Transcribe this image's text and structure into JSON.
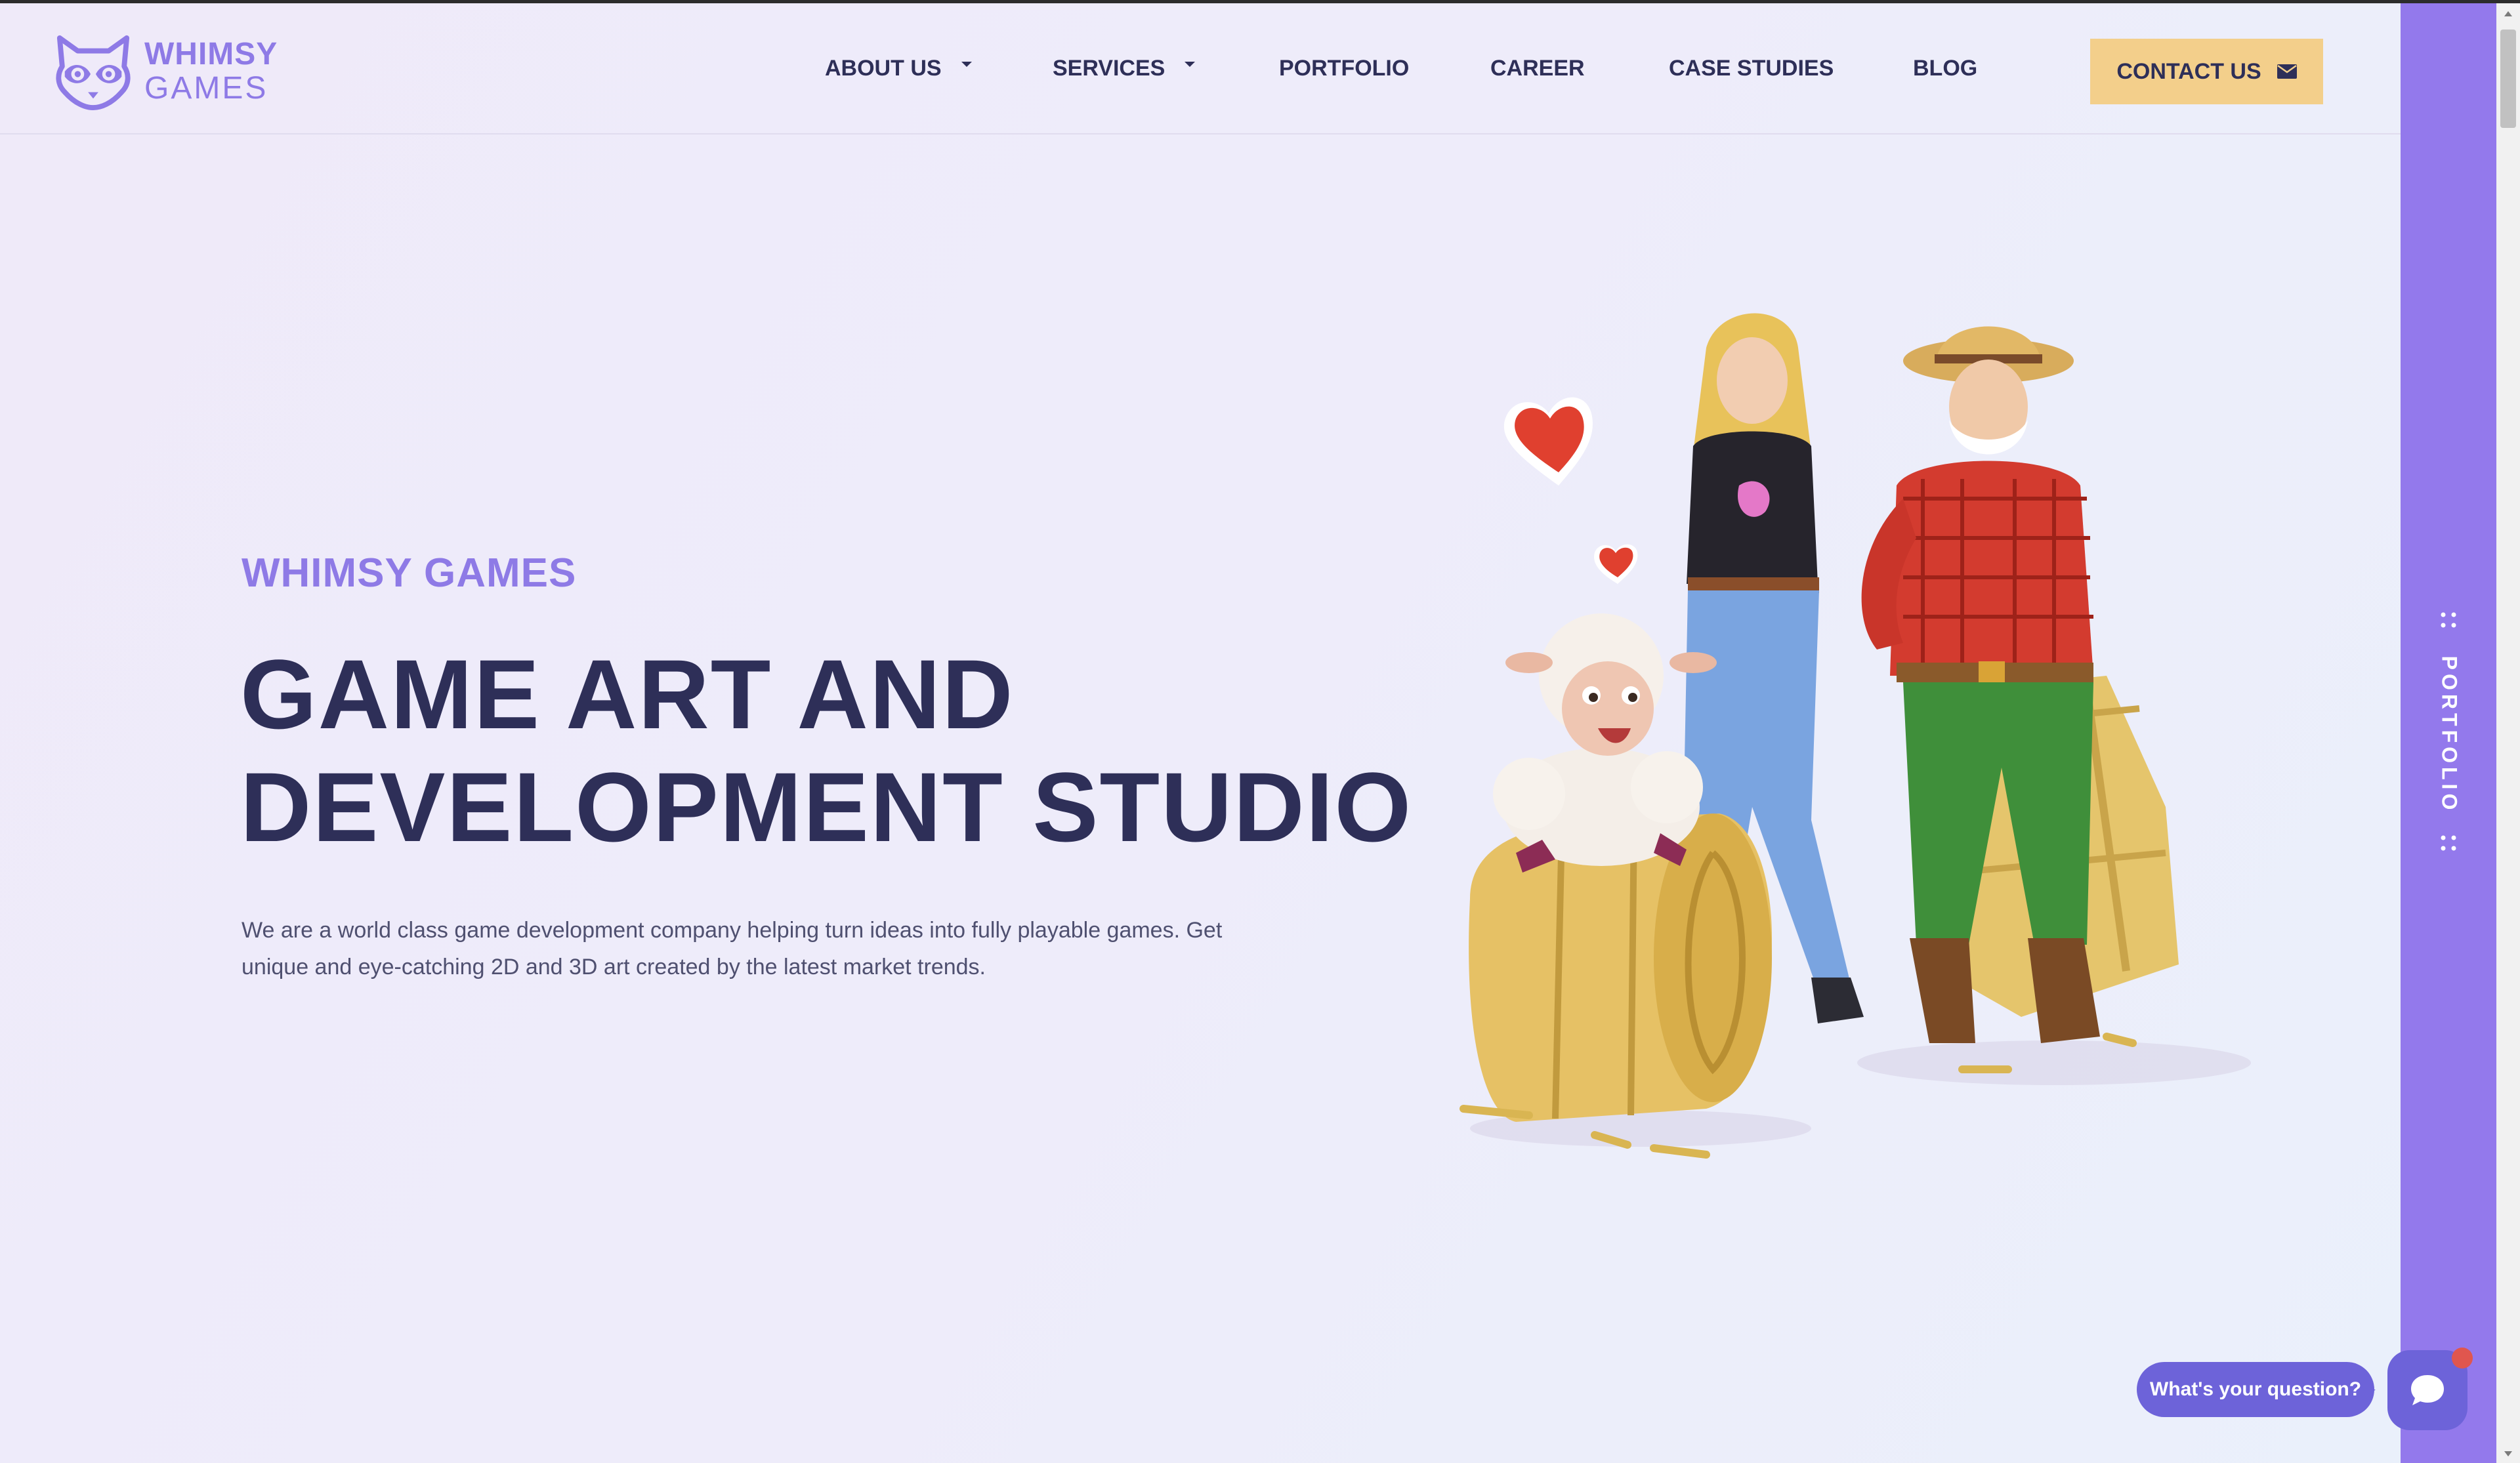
{
  "brand": {
    "logo_line1": "WHIMSY",
    "logo_line2": "GAMES",
    "accent_color": "#8e7ae6",
    "dark_color": "#2e2f58",
    "button_color": "#f3cf8b",
    "rail_color": "#9379ec"
  },
  "nav": {
    "items": [
      {
        "label": "ABOUT US",
        "has_dropdown": true
      },
      {
        "label": "SERVICES",
        "has_dropdown": true
      },
      {
        "label": "PORTFOLIO",
        "has_dropdown": false
      },
      {
        "label": "CAREER",
        "has_dropdown": false
      },
      {
        "label": "CASE STUDIES",
        "has_dropdown": false
      },
      {
        "label": "BLOG",
        "has_dropdown": false
      }
    ],
    "contact_label": "CONTACT US",
    "contact_icon": "mail-icon"
  },
  "hero": {
    "eyebrow": "WHIMSY GAMES",
    "title_line1": "GAME ART AND",
    "title_line2": "DEVELOPMENT STUDIO",
    "description": "We are a world class game development company helping turn ideas into fully playable games. Get unique and eye-catching 2D and 3D art created by the latest market trends."
  },
  "side_rail": {
    "label": "PORTFOLIO"
  },
  "chat": {
    "prompt": "What's your question?",
    "icon": "chat-icon"
  }
}
